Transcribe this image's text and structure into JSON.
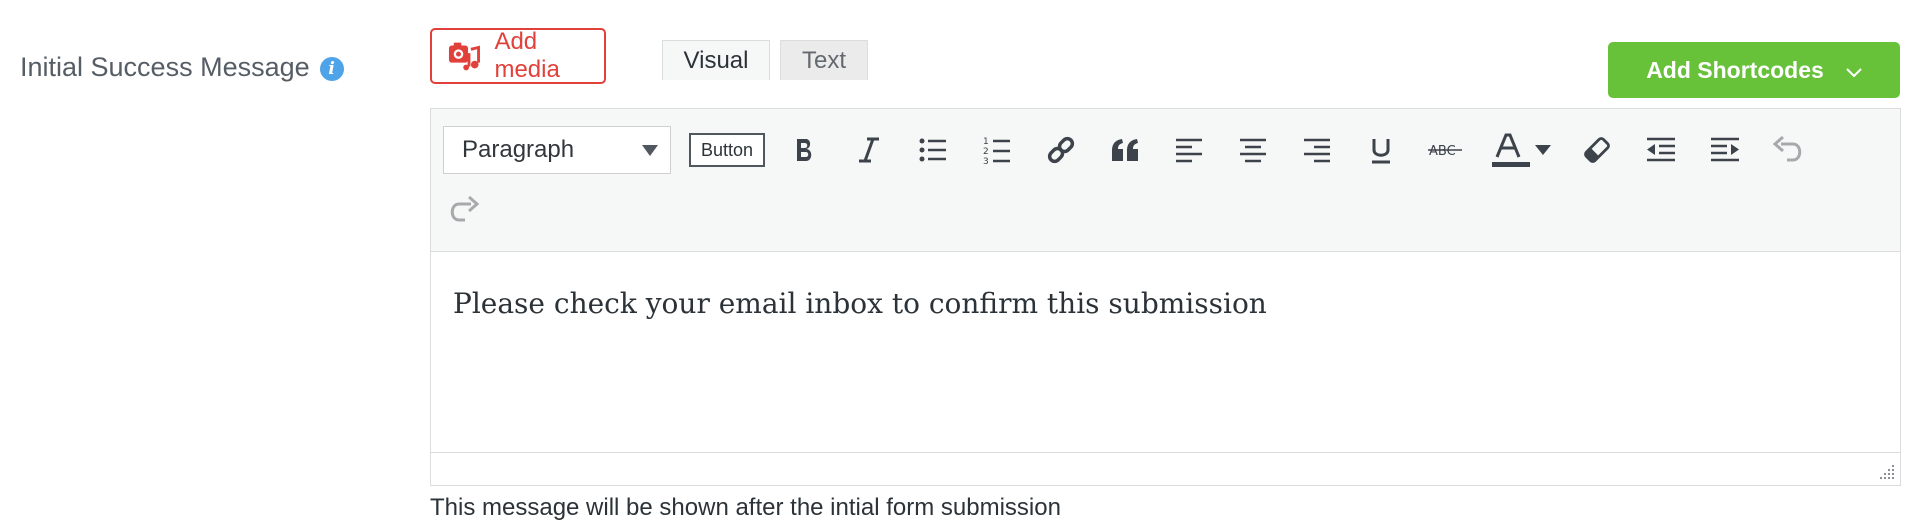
{
  "field": {
    "label": "Initial Success Message",
    "info_glyph": "i"
  },
  "media": {
    "label": "Add media"
  },
  "tabs": {
    "visual": "Visual",
    "text": "Text"
  },
  "shortcodes": {
    "label": "Add Shortcodes",
    "chevron": "﹀"
  },
  "toolbar": {
    "format_selected": "Paragraph",
    "button_label": "Button"
  },
  "editor": {
    "content": "Please check your email inbox to confirm this submission"
  },
  "hint": "This message will be shown after the intial form submission",
  "colors": {
    "accent_red": "#e2403a",
    "accent_green": "#67c23a",
    "info_blue": "#4fa3e8"
  }
}
